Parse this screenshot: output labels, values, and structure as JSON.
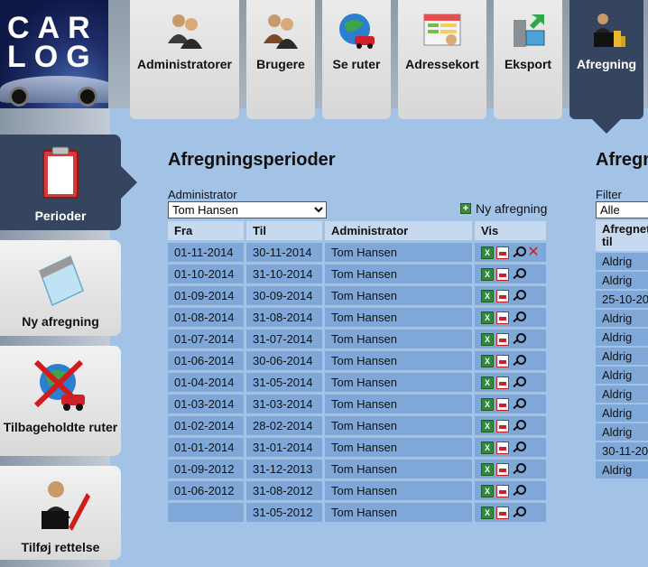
{
  "logo": {
    "line1": "CAR",
    "line2": "LOG"
  },
  "nav": [
    {
      "label": "Administratorer",
      "icon": "users-icon"
    },
    {
      "label": "Brugere",
      "icon": "users-icon"
    },
    {
      "label": "Se ruter",
      "icon": "globe-car-icon"
    },
    {
      "label": "Adressekort",
      "icon": "address-card-icon"
    },
    {
      "label": "Eksport",
      "icon": "computer-export-icon"
    },
    {
      "label": "Afregning",
      "icon": "briefcase-money-icon"
    }
  ],
  "sidebar": [
    {
      "label": "Perioder",
      "icon": "clipboard-icon"
    },
    {
      "label": "Ny afregning",
      "icon": "notepad-icon"
    },
    {
      "label": "Tilbageholdte ruter",
      "icon": "globe-car-cross-icon"
    },
    {
      "label": "Tilføj rettelse",
      "icon": "person-pencil-icon"
    }
  ],
  "main": {
    "title": "Afregningsperioder",
    "admin_label": "Administrator",
    "admin_selected": "Tom Hansen",
    "new_label": "Ny afregning",
    "columns": [
      "Fra",
      "Til",
      "Administrator",
      "Vis"
    ],
    "rows": [
      {
        "fra": "01-11-2014",
        "til": "30-11-2014",
        "admin": "Tom Hansen",
        "deletable": true
      },
      {
        "fra": "01-10-2014",
        "til": "31-10-2014",
        "admin": "Tom Hansen"
      },
      {
        "fra": "01-09-2014",
        "til": "30-09-2014",
        "admin": "Tom Hansen"
      },
      {
        "fra": "01-08-2014",
        "til": "31-08-2014",
        "admin": "Tom Hansen"
      },
      {
        "fra": "01-07-2014",
        "til": "31-07-2014",
        "admin": "Tom Hansen"
      },
      {
        "fra": "01-06-2014",
        "til": "30-06-2014",
        "admin": "Tom Hansen"
      },
      {
        "fra": "01-04-2014",
        "til": "31-05-2014",
        "admin": "Tom Hansen"
      },
      {
        "fra": "01-03-2014",
        "til": "31-03-2014",
        "admin": "Tom Hansen"
      },
      {
        "fra": "01-02-2014",
        "til": "28-02-2014",
        "admin": "Tom Hansen"
      },
      {
        "fra": "01-01-2014",
        "til": "31-01-2014",
        "admin": "Tom Hansen"
      },
      {
        "fra": "01-09-2012",
        "til": "31-12-2013",
        "admin": "Tom Hansen"
      },
      {
        "fra": "01-06-2012",
        "til": "31-08-2012",
        "admin": "Tom Hansen"
      },
      {
        "fra": "",
        "til": "31-05-2012",
        "admin": "Tom Hansen"
      }
    ]
  },
  "right": {
    "title": "Afregn",
    "filter_label": "Filter",
    "filter_selected": "Alle",
    "column": "Afregnet til",
    "rows": [
      "Aldrig",
      "Aldrig",
      "25-10-20",
      "Aldrig",
      "Aldrig",
      "Aldrig",
      "Aldrig",
      "Aldrig",
      "Aldrig",
      "Aldrig",
      "30-11-20",
      "Aldrig"
    ]
  }
}
